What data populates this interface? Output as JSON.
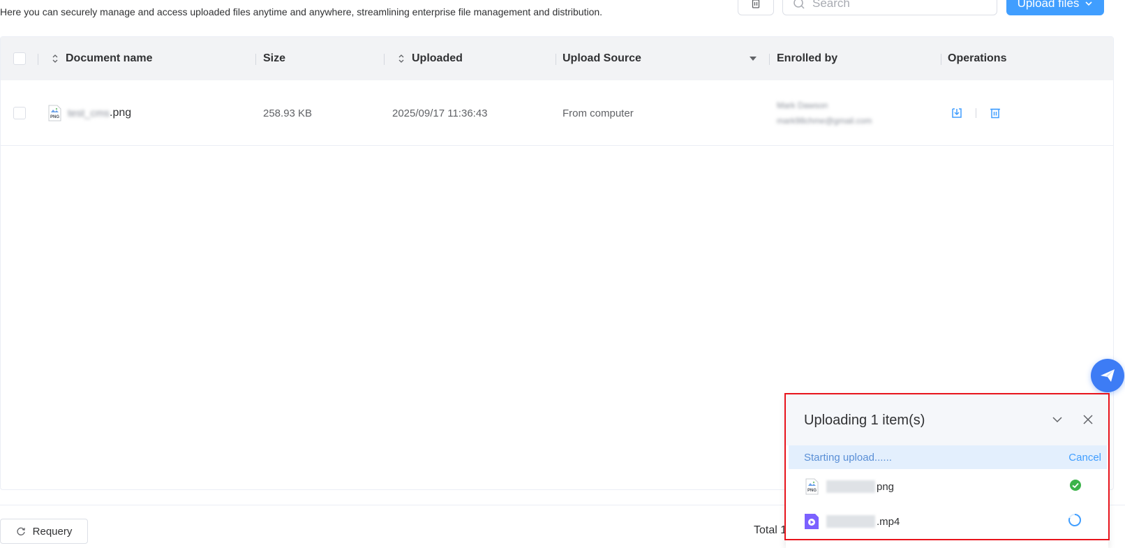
{
  "header": {
    "description": "Here you can securely manage and access uploaded files anytime and anywhere, streamlining enterprise file management and distribution.",
    "search_placeholder": "Search",
    "upload_button_label": "Upload files"
  },
  "table": {
    "columns": {
      "document_name": "Document name",
      "size": "Size",
      "uploaded": "Uploaded",
      "upload_source": "Upload Source",
      "enrolled_by": "Enrolled by",
      "operations": "Operations"
    },
    "rows": [
      {
        "file_type": "PNG",
        "name_blurred": "test_cms",
        "extension": ".png",
        "size": "258.93 KB",
        "uploaded": "2025/09/17 11:36:43",
        "source": "From computer",
        "enrolled_name_blurred": "Mark Dawson",
        "enrolled_email_blurred": "mark98chme@gmail.com"
      }
    ]
  },
  "footer": {
    "requery_label": "Requery",
    "total_label": "Total 1"
  },
  "upload_panel": {
    "title": "Uploading 1 item(s)",
    "status_text": "Starting upload......",
    "cancel_label": "Cancel",
    "items": [
      {
        "type": "PNG",
        "extension": "png",
        "status": "done"
      },
      {
        "type": "video",
        "extension": ".mp4",
        "status": "uploading"
      }
    ]
  },
  "colors": {
    "primary": "#409eff",
    "success": "#3bb34a",
    "highlight": "#e8141c"
  }
}
